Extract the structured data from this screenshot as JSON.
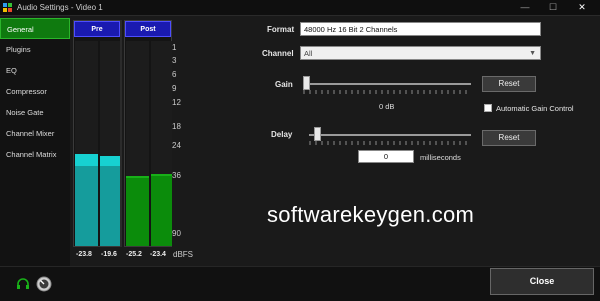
{
  "window": {
    "title": "Audio Settings - Video 1",
    "minimize": "—",
    "maximize": "☐",
    "close": "✕"
  },
  "sidebar": {
    "items": [
      {
        "label": "General",
        "active": true
      },
      {
        "label": "Plugins"
      },
      {
        "label": "EQ"
      },
      {
        "label": "Compressor"
      },
      {
        "label": "Noise Gate"
      },
      {
        "label": "Channel Mixer"
      },
      {
        "label": "Channel Matrix"
      }
    ]
  },
  "meters": {
    "pre": {
      "label": "Pre",
      "left_value": "-23.8",
      "right_value": "-19.6",
      "left_level": 0.39,
      "right_level": 0.39,
      "left_peak": 0.45,
      "right_peak": 0.44,
      "color": "#159c9c",
      "peak_color": "#17d1d1"
    },
    "post": {
      "label": "Post",
      "left_value": "-25.2",
      "right_value": "-23.4",
      "left_level": 0.33,
      "right_level": 0.34,
      "color": "#0b8c0b",
      "peak_color": "#18b018"
    },
    "scale": [
      "1",
      "3",
      "6",
      "9",
      "12",
      "18",
      "24",
      "36",
      "90"
    ],
    "unit": "dBFS"
  },
  "general": {
    "format_label": "Format",
    "format_value": "48000 Hz 16 Bit 2 Channels",
    "channel_label": "Channel",
    "channel_value": "All",
    "gain_label": "Gain",
    "gain_value": "0 dB",
    "gain_position": 0.0,
    "reset_label": "Reset",
    "agc_label": "Automatic Gain Control",
    "agc_checked": false,
    "delay_label": "Delay",
    "delay_value": "0",
    "delay_unit": "milliseconds",
    "delay_position": 0.03
  },
  "watermark": "softwarekeygen.com",
  "footer": {
    "close_label": "Close"
  },
  "colors": {
    "accent_green": "#0f7a0f",
    "meter_header": "#1a1ab0",
    "background": "#1a1a1a"
  }
}
